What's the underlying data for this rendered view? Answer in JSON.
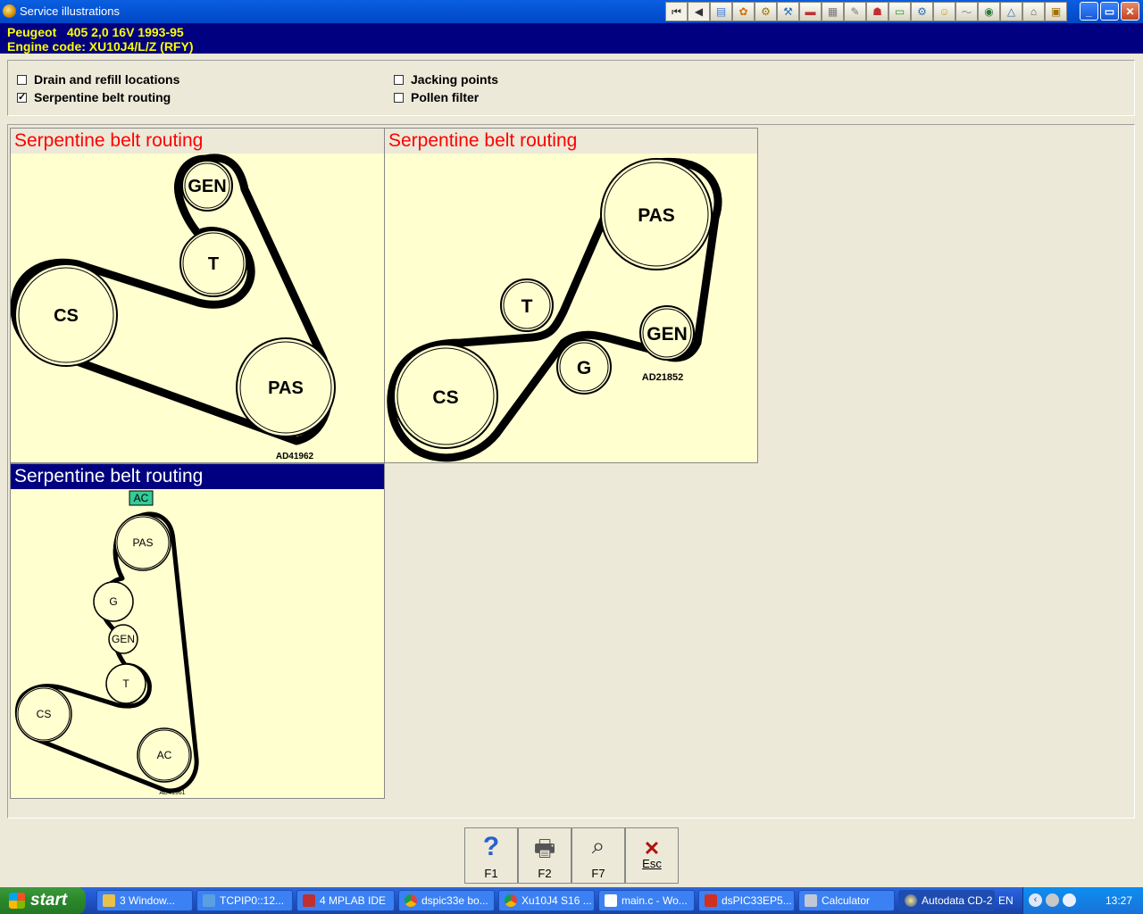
{
  "window": {
    "title": "Service illustrations",
    "minimize": "_",
    "maximize": "▭",
    "close": "✕"
  },
  "toolbar": {
    "tools": [
      "first-page",
      "previous-page",
      "tool-1",
      "tool-2",
      "tool-3",
      "tool-4",
      "tool-5",
      "tool-6",
      "tool-7",
      "tool-8",
      "tool-9",
      "tool-10",
      "tool-11",
      "tool-12",
      "tool-13",
      "tool-14",
      "tool-15",
      "tool-16",
      "tool-17"
    ]
  },
  "vehicle": {
    "line1": "Peugeot   405 2,0 16V 1993-95",
    "line2": "Engine code: XU10J4/L/Z (RFY)"
  },
  "options": [
    {
      "label": "Drain and refill locations",
      "checked": false
    },
    {
      "label": "Serpentine belt routing",
      "checked": true
    },
    {
      "label": "Jacking points",
      "checked": false
    },
    {
      "label": "Pollen filter",
      "checked": false
    }
  ],
  "illustrations": [
    {
      "title": "Serpentine belt routing",
      "code": "AD41962",
      "pulleys": [
        "GEN",
        "T",
        "CS",
        "PAS"
      ]
    },
    {
      "title": "Serpentine belt routing",
      "code": "AD21852",
      "pulleys": [
        "PAS",
        "T",
        "GEN",
        "G",
        "CS"
      ]
    },
    {
      "title": "Serpentine belt routing",
      "code": "AD41961",
      "tag": "AC",
      "pulleys": [
        "PAS",
        "G",
        "GEN",
        "T",
        "CS",
        "AC"
      ]
    }
  ],
  "fkeys": [
    {
      "label": "F1",
      "icon": "help-icon"
    },
    {
      "label": "F2",
      "icon": "printer-icon"
    },
    {
      "label": "F7",
      "icon": "magnifier-icon"
    },
    {
      "label": "Esc",
      "icon": "close-icon"
    }
  ],
  "taskbar": {
    "start": "start",
    "tasks": [
      {
        "label": "3 Window...",
        "icon_color": "#e8c04a"
      },
      {
        "label": "TCPIP0::12...",
        "icon_color": "#5aa0e0"
      },
      {
        "label": "4 MPLAB IDE",
        "icon_color": "#c03030"
      },
      {
        "label": "dspic33e bo...",
        "icon_color": "#e0b020"
      },
      {
        "label": "Xu10J4 S16 ...",
        "icon_color": "#e0b020"
      },
      {
        "label": "main.c - Wo...",
        "icon_color": "#ffffff"
      },
      {
        "label": "dsPIC33EP5...",
        "icon_color": "#d03020"
      },
      {
        "label": "Calculator",
        "icon_color": "#c0c8d8"
      },
      {
        "label": "Autodata CD-2",
        "icon_color": "#e0b020"
      }
    ],
    "lang": "EN",
    "time": "13:27"
  }
}
